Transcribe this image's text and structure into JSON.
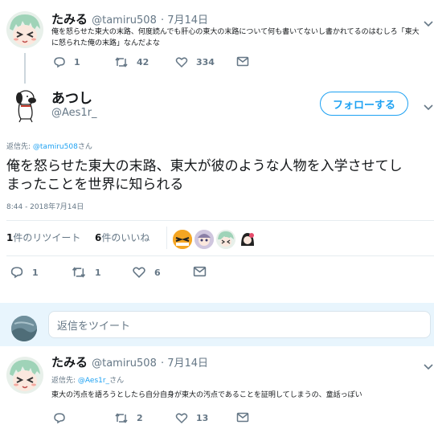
{
  "tweet1": {
    "name": "たみる",
    "handle": "@tamiru508",
    "date": "· 7月14日",
    "text1": "俺を怒らせた東大の末路、何度読んでも肝心の東大の末路について何も書いてないし書かれてるのはむしろ「東大",
    "text2": "に怒られた俺の末路」なんだよな",
    "replies": "1",
    "retweets": "42",
    "likes": "334"
  },
  "main": {
    "name": "あつし",
    "handle": "@Aes1r_",
    "follow_label": "フォローする",
    "reply_to_label": "返信先: ",
    "reply_to_handle": "@tamiru508",
    "reply_to_suffix": "さん",
    "text1": "俺を怒らせた東大の末路、東大が彼のような人物を入学させてし",
    "text2": "まったことを世界に知られる",
    "timestamp": "8:44 - 2018年7月14日",
    "retweet_count": "1",
    "retweet_label": "件のリツイート",
    "like_count": "6",
    "like_label": "件のいいね",
    "replies": "1",
    "retweets": "1",
    "likes": "6"
  },
  "reply_box": {
    "placeholder": "返信をツイート"
  },
  "tweet3": {
    "name": "たみる",
    "handle": "@tamiru508",
    "date": "· 7月14日",
    "reply_to_label": "返信先: ",
    "reply_to_handle": "@Aes1r_",
    "reply_to_suffix": "さん",
    "text": "東大の汚点を語ろうとしたら自分自身が東大の汚点であることを証明してしまうの、童話っぽい",
    "replies": "",
    "retweets": "2",
    "likes": "13"
  },
  "colors": {
    "accent": "#1da1f2",
    "text": "#14171a",
    "secondary": "#657786",
    "divider": "#e6ecf0"
  }
}
